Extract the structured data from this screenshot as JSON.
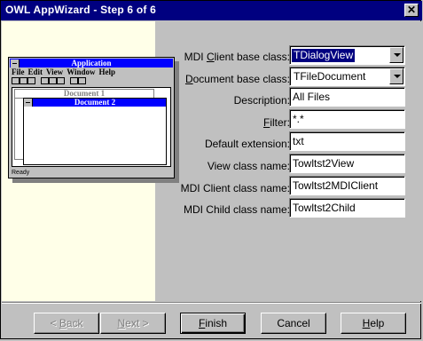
{
  "window": {
    "title": "OWL AppWizard - Step 6 of 6",
    "close_glyph": "✕"
  },
  "preview": {
    "app_title": "Application",
    "menu": [
      "File",
      "Edit",
      "View",
      "Window",
      "Help"
    ],
    "doc1_title": "Document 1",
    "doc2_title": "Document 2",
    "status": "Ready"
  },
  "form": {
    "mdi_client_base_class": {
      "label_pre": "MDI ",
      "label_ul": "C",
      "label_post": "lient base class:",
      "value": "TDialogView"
    },
    "document_base_class": {
      "label_pre": "",
      "label_ul": "D",
      "label_post": "ocument base class:",
      "value": "TFileDocument"
    },
    "description": {
      "label_pre": "Description",
      "label_ul": "",
      "label_post": ":",
      "value": "All Files"
    },
    "filter": {
      "label_pre": "",
      "label_ul": "F",
      "label_post": "ilter:",
      "value": "*.*"
    },
    "default_extension": {
      "label": "Default extension:",
      "value": "txt"
    },
    "view_class_name": {
      "label": "View class name:",
      "value": "Towltst2View"
    },
    "mdi_client_class_name": {
      "label": "MDI Client class name:",
      "value": "Towltst2MDIClient"
    },
    "mdi_child_class_name": {
      "label": "MDI Child class name:",
      "value": "Towltst2Child"
    }
  },
  "buttons": {
    "back": {
      "prefix": "< ",
      "ul": "B",
      "rest": "ack"
    },
    "next": {
      "prefix": "",
      "ul": "N",
      "rest": "ext >"
    },
    "finish": {
      "prefix": "",
      "ul": "F",
      "rest": "inish"
    },
    "cancel": {
      "label": "Cancel"
    },
    "help": {
      "prefix": "",
      "ul": "H",
      "rest": "elp"
    }
  },
  "colors": {
    "title_bg": "#000080",
    "preview_title_bg": "#0000ff",
    "face": "#c0c0c0",
    "left_pane": "#ffffe8"
  }
}
